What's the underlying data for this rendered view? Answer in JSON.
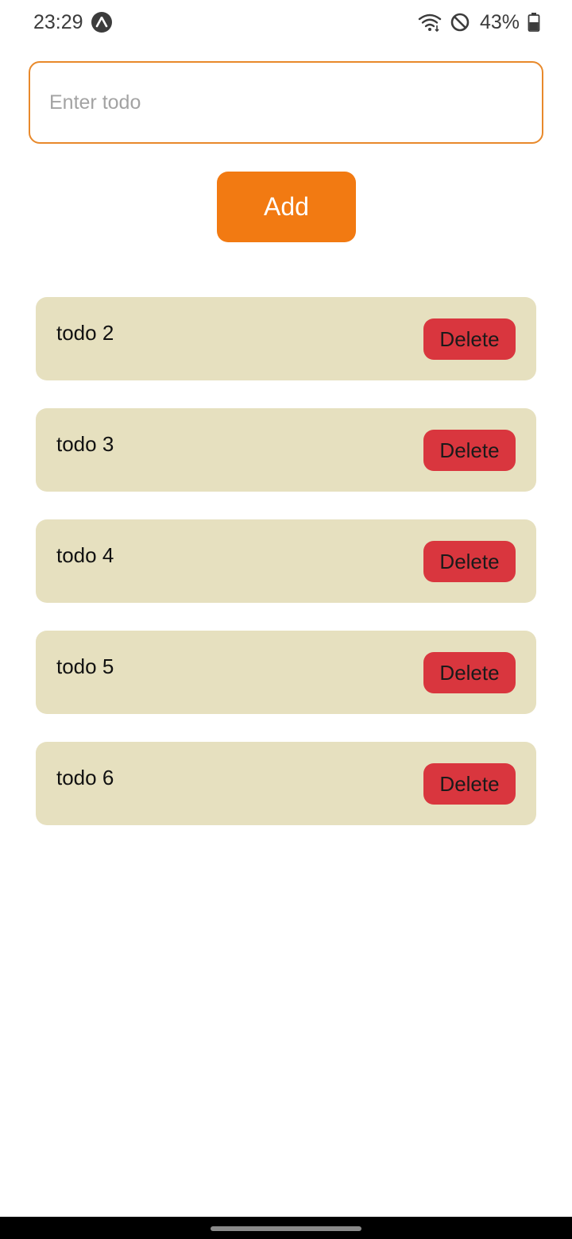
{
  "status_bar": {
    "time": "23:29",
    "battery": "43%",
    "icons": [
      "app-notification-icon",
      "wifi-icon",
      "do-not-disturb-icon",
      "battery-icon"
    ]
  },
  "input": {
    "placeholder": "Enter todo",
    "value": ""
  },
  "add_button": {
    "label": "Add"
  },
  "todos": [
    {
      "text": "todo 2",
      "delete_label": "Delete"
    },
    {
      "text": "todo 3",
      "delete_label": "Delete"
    },
    {
      "text": "todo 4",
      "delete_label": "Delete"
    },
    {
      "text": "todo 5",
      "delete_label": "Delete"
    },
    {
      "text": "todo 6",
      "delete_label": "Delete"
    }
  ],
  "colors": {
    "accent": "#f27a12",
    "input_border": "#e8892b",
    "todo_background": "#e6e0bf",
    "delete_button": "#d9363e"
  }
}
